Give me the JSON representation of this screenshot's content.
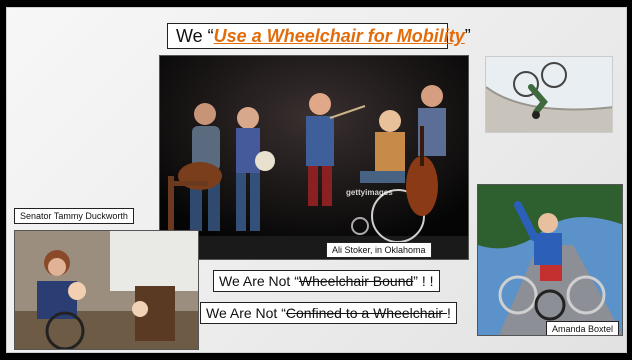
{
  "slide": {
    "title": {
      "prefix": "We “",
      "emphasis": "Use a Wheelchair for Mobility",
      "suffix": "”"
    },
    "statements": [
      {
        "prefix": "We Are Not “",
        "struck": "Wheelchair Bound",
        "suffix": "” ! !"
      },
      {
        "prefix": "We Are Not “",
        "struck": "Confined to a Wheelchair ",
        "suffix": "!"
      }
    ],
    "captions": {
      "duckworth": "Senator Tammy Duckworth",
      "stoker": "Ali Stoker, in Oklahoma",
      "boxtel": "Amanda Boxtel"
    },
    "watermark": "gettyimages",
    "colors": {
      "accent": "#e36c0a",
      "stage_bg": "#0b0b0b",
      "sky": "#5a92c9",
      "ramp": "#c9c4bb"
    },
    "photos": [
      "stage-musicians-photo",
      "skatepark-wheelchair-photo",
      "handcycle-rider-photo",
      "senator-with-child-photo"
    ]
  }
}
